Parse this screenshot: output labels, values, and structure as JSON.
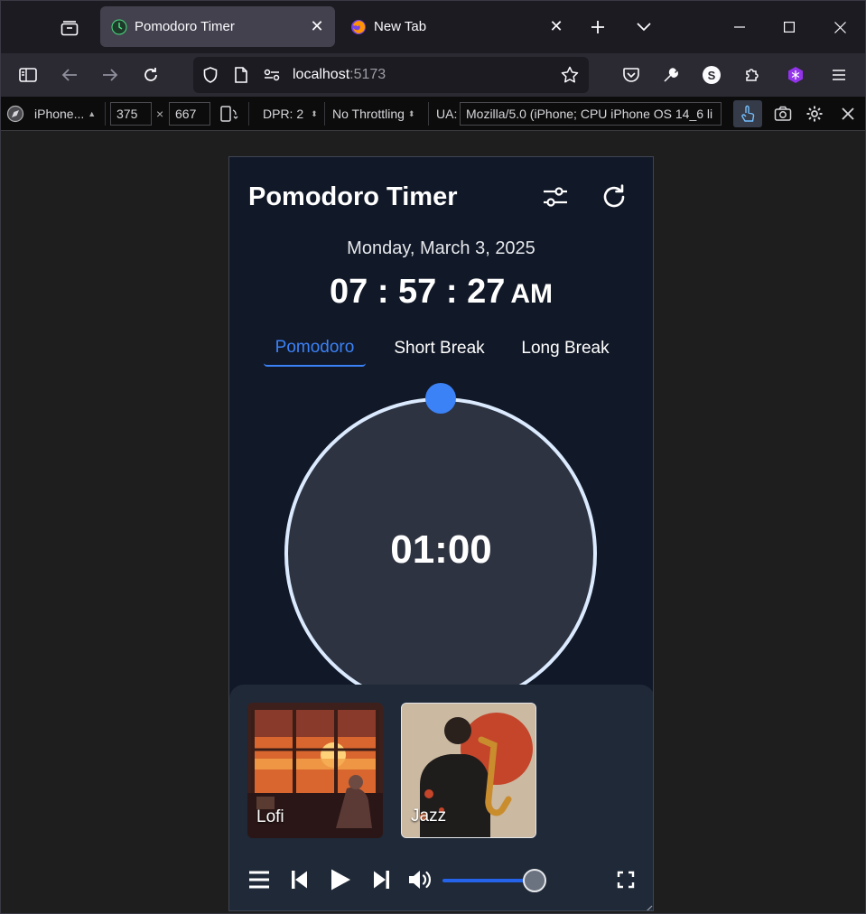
{
  "browser": {
    "tabs": [
      {
        "title": "Pomodoro Timer",
        "active": true,
        "favicon": "clock-favicon"
      },
      {
        "title": "New Tab",
        "active": false,
        "favicon": "firefox-favicon"
      }
    ],
    "url_host": "localhost",
    "url_port": ":5173",
    "account_initial": "S"
  },
  "devtools": {
    "device": "iPhone...",
    "width": "375",
    "height": "667",
    "times": "×",
    "dpr": "DPR: 2",
    "throttling": "No Throttling",
    "ua_label": "UA:",
    "ua_value": "Mozilla/5.0 (iPhone; CPU iPhone OS 14_6 li"
  },
  "app": {
    "title": "Pomodoro Timer",
    "date": "Monday, March 3, 2025",
    "clock": {
      "time": "07 : 57 : 27",
      "ampm": "AM"
    },
    "modes": [
      {
        "label": "Pomodoro",
        "active": true
      },
      {
        "label": "Short Break",
        "active": false
      },
      {
        "label": "Long Break",
        "active": false
      }
    ],
    "timer": "01:00",
    "progress": 0.0,
    "playlists": [
      {
        "label": "Lofi"
      },
      {
        "label": "Jazz"
      }
    ],
    "volume": 0.85,
    "colors": {
      "accent": "#3b82f6",
      "background": "#111827",
      "panel": "#1f2937",
      "ring": "#dbeafe"
    }
  }
}
